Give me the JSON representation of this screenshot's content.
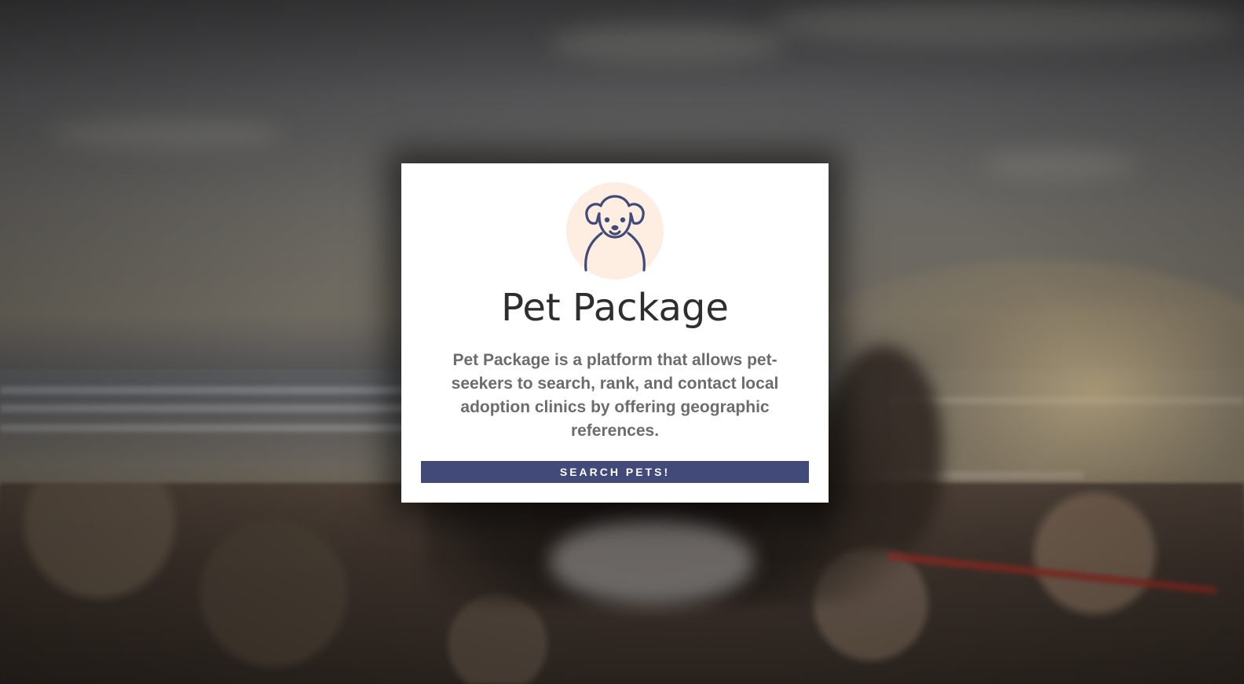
{
  "app": {
    "title": "Pet Package",
    "description": "Pet Package is a platform that allows pet-seekers to search, rank, and contact local adoption clinics by offering geographic references.",
    "cta_label": "SEARCH PETS!",
    "logo_icon": "dog-icon"
  },
  "colors": {
    "button_background": "#414a78",
    "button_text": "#ffffff",
    "icon_stroke": "#414a78",
    "icon_circle": "#fdeee1",
    "title_text": "#2e2e2e",
    "description_text": "#6c6c6c",
    "card_background": "#ffffff"
  }
}
